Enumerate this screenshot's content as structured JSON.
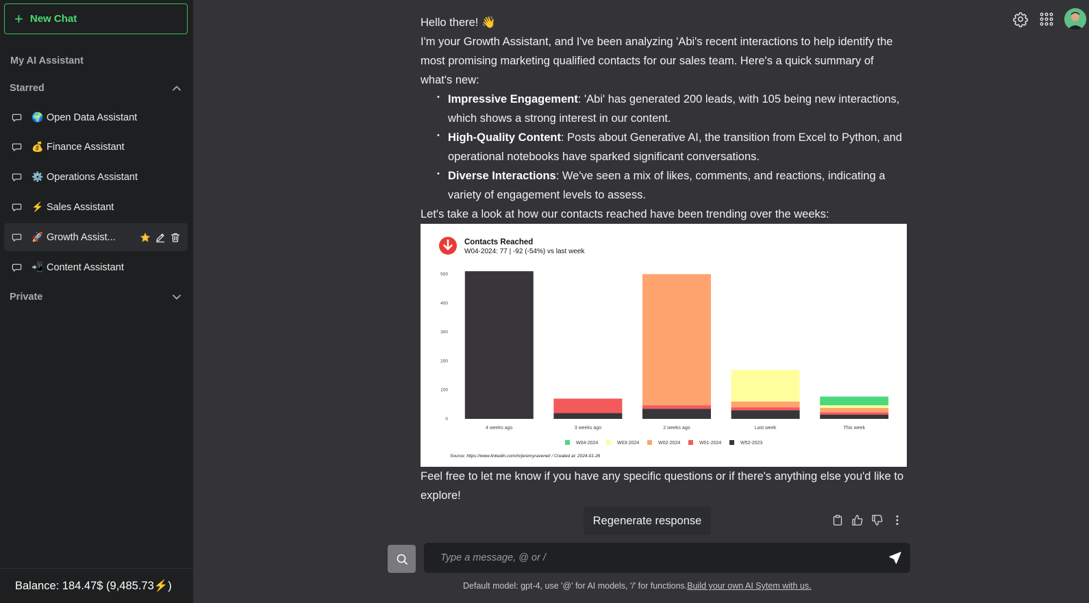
{
  "sidebar": {
    "new_chat_label": "New Chat",
    "heading": "My AI Assistant",
    "starred_label": "Starred",
    "private_label": "Private",
    "items": [
      {
        "emoji": "🌍",
        "label": "Open Data Assistant"
      },
      {
        "emoji": "💰",
        "label": "Finance Assistant"
      },
      {
        "emoji": "⚙️",
        "label": "Operations Assistant"
      },
      {
        "emoji": "⚡",
        "label": "Sales Assistant"
      },
      {
        "emoji": "🚀",
        "label": "Growth Assist..."
      },
      {
        "emoji": "📲",
        "label": "Content Assistant"
      }
    ],
    "balance": "Balance: 184.47$ (9,485.73⚡)"
  },
  "message": {
    "greeting": "Hello there! 👋",
    "intro": "I'm your Growth Assistant, and I've been analyzing 'Abi's recent interactions to help identify the most promising marketing qualified contacts for our sales team. Here's a quick summary of what's new:",
    "bullets": [
      {
        "title": "Impressive Engagement",
        "text": ": 'Abi' has generated 200 leads, with 105 being new interactions, which shows a strong interest in our content."
      },
      {
        "title": "High-Quality Content",
        "text": ": Posts about Generative AI, the transition from Excel to Python, and operational notebooks have sparked significant conversations."
      },
      {
        "title": "Diverse Interactions",
        "text": ": We've seen a mix of likes, comments, and reactions, indicating a variety of engagement levels to assess."
      }
    ],
    "chart_intro": "Let's take a look at how our contacts reached have been trending over the weeks:",
    "closing": "Feel free to let me know if you have any specific questions or if there's anything else you'd like to explore!"
  },
  "chart_data": {
    "type": "bar",
    "stacked": true,
    "title": "Contacts Reached",
    "subtitle": "W04-2024: 77 | -92 (-54%) vs last week",
    "categories": [
      "4 weeks ago",
      "3 weeks ago",
      "2 weeks ago",
      "Last week",
      "This week"
    ],
    "series": [
      {
        "name": "W52-2023",
        "color": "#38363a",
        "values": [
          510,
          20,
          35,
          30,
          15
        ]
      },
      {
        "name": "W01-2024",
        "color": "#f45a5b",
        "values": [
          0,
          50,
          12,
          10,
          8
        ]
      },
      {
        "name": "W02-2024",
        "color": "#ffa36f",
        "values": [
          0,
          0,
          453,
          20,
          15
        ]
      },
      {
        "name": "W03-2024",
        "color": "#fefe9d",
        "values": [
          0,
          0,
          0,
          109,
          9
        ]
      },
      {
        "name": "W04-2024",
        "color": "#4cd97b",
        "values": [
          0,
          0,
          0,
          0,
          30
        ]
      }
    ],
    "legend_order": [
      "W04-2024",
      "W03-2024",
      "W02-2024",
      "W01-2024",
      "W52-2023"
    ],
    "yticks": [
      "0",
      "100",
      "200",
      "300",
      "400",
      "500"
    ],
    "ylim": [
      0,
      520
    ],
    "legend": "bottom",
    "source": "Source: https://www.linkedin.com/in/jeremyravenel/ / Created at: 2024-01-26"
  },
  "actions": {
    "regenerate_label": "Regenerate response"
  },
  "input": {
    "placeholder": "Type a message, @ or /"
  },
  "footer": {
    "text": "Default model: gpt-4, use '@' for AI models, '/' for functions.",
    "link": "Build your own AI Sytem with us."
  }
}
